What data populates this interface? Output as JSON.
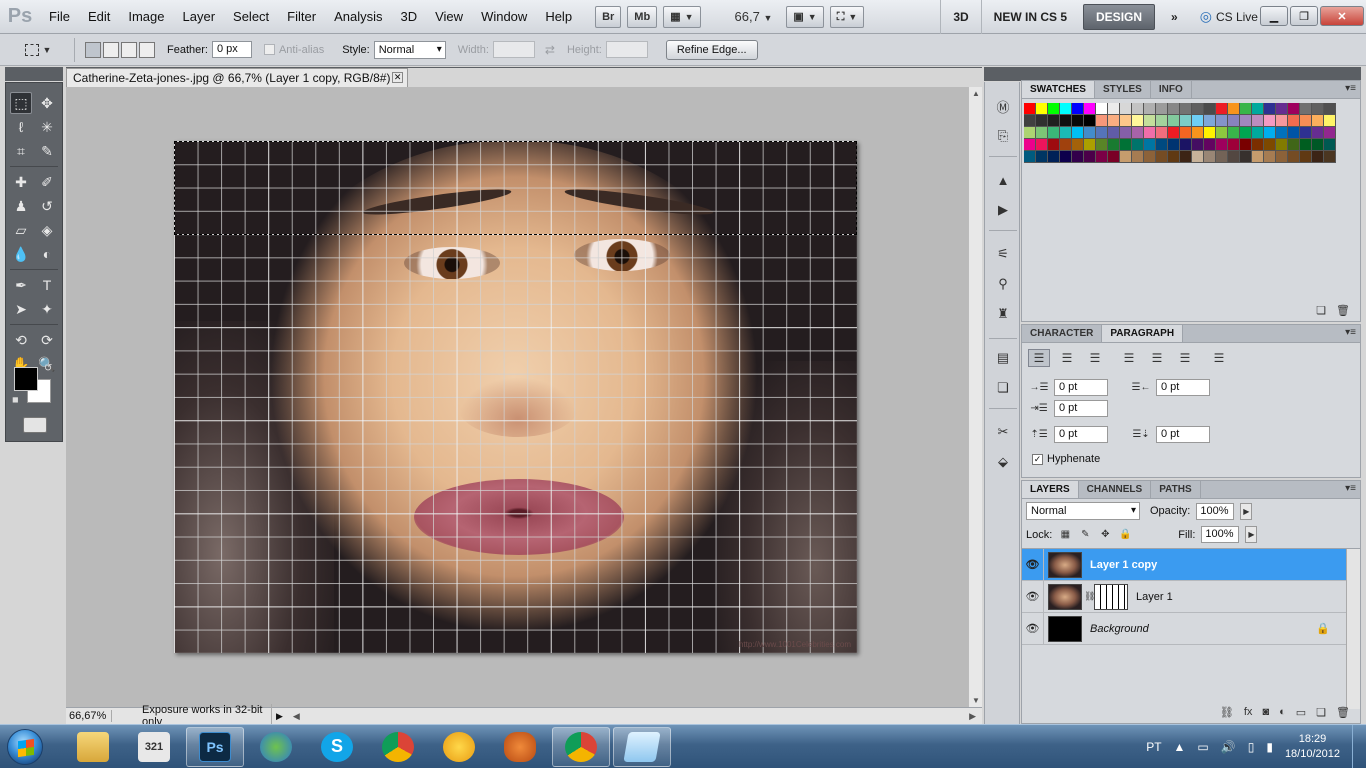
{
  "app": {
    "logo": "Ps"
  },
  "menu": [
    "File",
    "Edit",
    "Image",
    "Layer",
    "Select",
    "Filter",
    "Analysis",
    "3D",
    "View",
    "Window",
    "Help"
  ],
  "appbar": {
    "bridge": "Br",
    "minibridge": "Mb",
    "zoom": "66,7"
  },
  "workspaces": {
    "threed": "3D",
    "new_in": "NEW IN CS 5",
    "design": "DESIGN",
    "more": "»",
    "cslive": "CS Live"
  },
  "options": {
    "feather_label": "Feather:",
    "feather_value": "0 px",
    "antialias_label": "Anti-alias",
    "style_label": "Style:",
    "style_value": "Normal",
    "width_label": "Width:",
    "height_label": "Height:",
    "refine_label": "Refine Edge..."
  },
  "document": {
    "tab_title": "Catherine-Zeta-jones-.jpg @ 66,7% (Layer 1 copy, RGB/8#) *",
    "watermark": "http://www.1001Celebrities.com"
  },
  "status": {
    "zoom": "66,67%",
    "info": "Exposure works in 32-bit only"
  },
  "swatches": {
    "tabs": [
      "SWATCHES",
      "STYLES",
      "INFO"
    ],
    "colors": [
      "#ff0000",
      "#ffff00",
      "#00ff00",
      "#00ffff",
      "#0000ff",
      "#ff00ff",
      "#ffffff",
      "#ebebeb",
      "#d7d7d7",
      "#c3c3c3",
      "#afafaf",
      "#9b9b9b",
      "#878787",
      "#737373",
      "#5f5f5f",
      "#4b4b4b",
      "#ed1c24",
      "#f7941d",
      "#39b54a",
      "#00a99d",
      "#2e3192",
      "#662d91",
      "#9e005d",
      "#707070",
      "#606060",
      "#505050",
      "#404040",
      "#303030",
      "#202020",
      "#101010",
      "#080808",
      "#000000",
      "#f7977a",
      "#f9ad81",
      "#fdc68a",
      "#fff79a",
      "#c4df9b",
      "#a3d39c",
      "#82ca9d",
      "#7bcdc8",
      "#6ecff6",
      "#7ea7d8",
      "#8493ca",
      "#8882be",
      "#a187be",
      "#bc8dbf",
      "#f49ac2",
      "#f6989d",
      "#f26c4f",
      "#f68e55",
      "#fbaf5c",
      "#fff467",
      "#acd372",
      "#7cc576",
      "#3bb878",
      "#1abbb4",
      "#00bff3",
      "#438ccb",
      "#5574b9",
      "#605ca8",
      "#855fa8",
      "#a763a8",
      "#f06ea9",
      "#f26d7d",
      "#ed1c24",
      "#f26522",
      "#f7941d",
      "#fff200",
      "#8dc73f",
      "#39b54a",
      "#00a651",
      "#00a99d",
      "#00aeef",
      "#0072bc",
      "#0054a6",
      "#2e3192",
      "#662d91",
      "#92278f",
      "#ec008c",
      "#ed145b",
      "#9e0b0f",
      "#a0410d",
      "#a3620a",
      "#aba000",
      "#598527",
      "#197b30",
      "#007236",
      "#00746b",
      "#0076a3",
      "#004a80",
      "#003471",
      "#1b1464",
      "#440e62",
      "#630460",
      "#9e005d",
      "#9e0039",
      "#790000",
      "#7b2e00",
      "#7d4900",
      "#827b00",
      "#406618",
      "#005e20",
      "#005826",
      "#005952",
      "#005b7f",
      "#003663",
      "#002157",
      "#0d004c",
      "#32004b",
      "#4b0049",
      "#7b0046",
      "#7a0026",
      "#c69c6d",
      "#a67c52",
      "#8c6239",
      "#754c24",
      "#603913",
      "#3c2415",
      "#c7b299",
      "#998675",
      "#736357",
      "#534741",
      "#37302d",
      "#c69c6d",
      "#a67c52",
      "#8c6239",
      "#754c24",
      "#603913",
      "#3c2415",
      "#4b3621"
    ]
  },
  "paragraph": {
    "tabs": [
      "CHARACTER",
      "PARAGRAPH"
    ],
    "indent_left": "0 pt",
    "indent_right": "0 pt",
    "indent_first": "0 pt",
    "space_before": "0 pt",
    "space_after": "0 pt",
    "hyphenate_label": "Hyphenate"
  },
  "layers": {
    "tabs": [
      "LAYERS",
      "CHANNELS",
      "PATHS"
    ],
    "blend_mode": "Normal",
    "opacity_label": "Opacity:",
    "opacity_value": "100%",
    "lock_label": "Lock:",
    "fill_label": "Fill:",
    "fill_value": "100%",
    "items": [
      {
        "name": "Layer 1 copy",
        "selected": true
      },
      {
        "name": "Layer 1",
        "selected": false
      },
      {
        "name": "Background",
        "selected": false
      }
    ]
  },
  "taskbar": {
    "tray_lang": "PT",
    "time": "18:29",
    "date": "18/10/2012",
    "app_ps": "Ps"
  }
}
